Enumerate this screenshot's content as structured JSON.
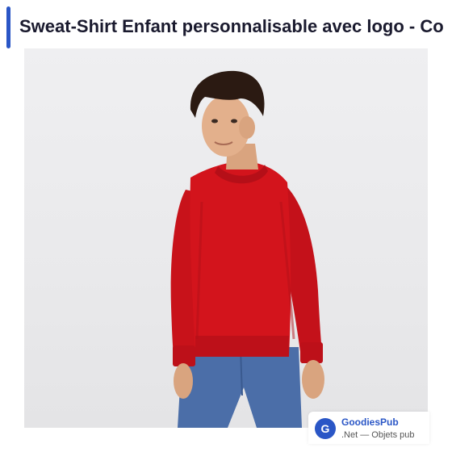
{
  "header": {
    "title": "Sweat-Shirt Enfant personnalisable avec logo - Co"
  },
  "product_image": {
    "subject": "child-red-sweatshirt-photo",
    "garment_color": "#d3141c",
    "background_color": "#ececee"
  },
  "source": {
    "logo_letter": "G",
    "name": "GoodiesPub",
    "subtitle": ".Net — Objets pub",
    "accent_color": "#2a56c6"
  }
}
